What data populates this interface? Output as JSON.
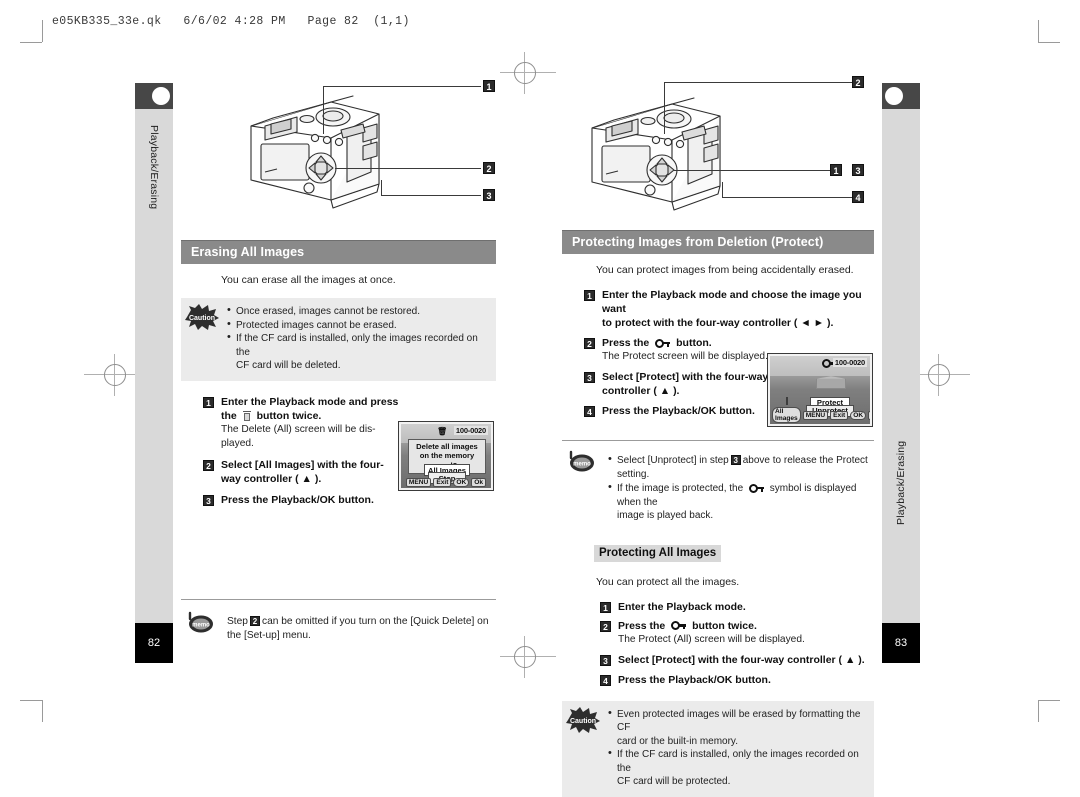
{
  "prepress": {
    "file_header": "e05KB335_33e.qk   6/6/02 4:28 PM   Page 82  (1,1)"
  },
  "left_page": {
    "tab_label": "Playback/Erasing",
    "page_number": "82",
    "figure": {
      "name": "camera-rear-illustration",
      "callouts": [
        "1",
        "2",
        "3"
      ]
    },
    "section_title": "Erasing All Images",
    "lead": "You can erase all the images at once.",
    "caution": {
      "icon_label": "Caution",
      "items": [
        "Once erased, images cannot be restored.",
        "Protected images cannot be erased.",
        "If the CF card is installed, only the images recorded on the",
        "CF card will be deleted."
      ]
    },
    "steps": [
      {
        "num": "1",
        "main_a": "Enter the Playback mode and press",
        "main_b": "the",
        "main_c": "button twice.",
        "sub": "The Delete (All) screen will be dis-played.",
        "sub_line1": "The Delete (All) screen will be dis-",
        "sub_line2": "played.",
        "icon": "trash-icon"
      },
      {
        "num": "2",
        "main_a": "Select [All Images] with the four-",
        "main_b": "way controller ( ▲ )."
      },
      {
        "num": "3",
        "main_a": "Press the Playback/OK button."
      }
    ],
    "memo": {
      "icon_label": "memo",
      "text_before": "Step",
      "step_ref": "2",
      "text_after": "can be omitted if you turn on the [Quick Delete] on the [Set-up] menu."
    },
    "lcd": {
      "file_number": "100-0020",
      "top_icon": "trash-icon",
      "dialog_line1": "Delete all images",
      "dialog_line2": "on the memory card?",
      "options": [
        "All Images",
        "Stop"
      ],
      "selected_option": "All Images",
      "bottom_bar": [
        "MENU",
        "Exit",
        "OK",
        "Ok"
      ]
    }
  },
  "right_page": {
    "tab_label": "Playback/Erasing",
    "page_number": "83",
    "figure": {
      "name": "camera-rear-illustration",
      "callouts": [
        "2",
        "1",
        "3",
        "4"
      ]
    },
    "section_title": "Protecting Images from Deletion (Protect)",
    "lead": "You can protect images from being accidentally erased.",
    "steps": [
      {
        "num": "1",
        "main_a": "Enter the Playback mode and choose the image you want",
        "main_b": "to protect with the four-way controller ( ◄ ► )."
      },
      {
        "num": "2",
        "main_a": "Press the",
        "main_c": "button.",
        "sub": "The Protect screen will be displayed.",
        "icon": "key-icon"
      },
      {
        "num": "3",
        "main_a": "Select [Protect] with the four-way",
        "main_b": "controller ( ▲ )."
      },
      {
        "num": "4",
        "main_a": "Press the Playback/OK button."
      }
    ],
    "memo": {
      "icon_label": "memo",
      "item1_before": "Select [Unprotect] in step",
      "item1_ref": "3",
      "item1_after": "above to release the Protect setting.",
      "item2_before": "If the image is protected, the",
      "item2_icon": "key-icon",
      "item2_after": "symbol is displayed when the",
      "item2_line2": "image is played back."
    },
    "subhead": "Protecting All Images",
    "sub_lead": "You can protect all the images.",
    "steps2": [
      {
        "num": "1",
        "main_a": "Enter the Playback mode."
      },
      {
        "num": "2",
        "main_a": "Press the",
        "main_c": "button twice.",
        "sub": "The Protect (All) screen will be displayed.",
        "icon": "key-icon"
      },
      {
        "num": "3",
        "main_a": "Select [Protect] with the four-way controller ( ▲ )."
      },
      {
        "num": "4",
        "main_a": "Press the Playback/OK button."
      }
    ],
    "caution": {
      "icon_label": "Caution",
      "items": [
        "Even protected images will be erased by formatting the CF",
        "card or the built-in memory.",
        "If the CF card is installed, only the images recorded on the",
        "CF card will be protected."
      ]
    },
    "lcd": {
      "file_number": "100-0020",
      "top_icon": "key-icon",
      "options": [
        "Protect",
        "Unprotect"
      ],
      "selected_option": "Protect",
      "bottom_bar": [
        "All Images",
        "MENU",
        "Exit",
        "OK",
        "Ok"
      ]
    }
  },
  "colors": {
    "section_bar": "#8a8a8a",
    "tab_bg": "#d9d9d9",
    "tab_cap": "#474747",
    "note_bg": "#ebebeb",
    "subhead_bg": "#d8d8d8",
    "pagenum_bg": "#000000"
  }
}
